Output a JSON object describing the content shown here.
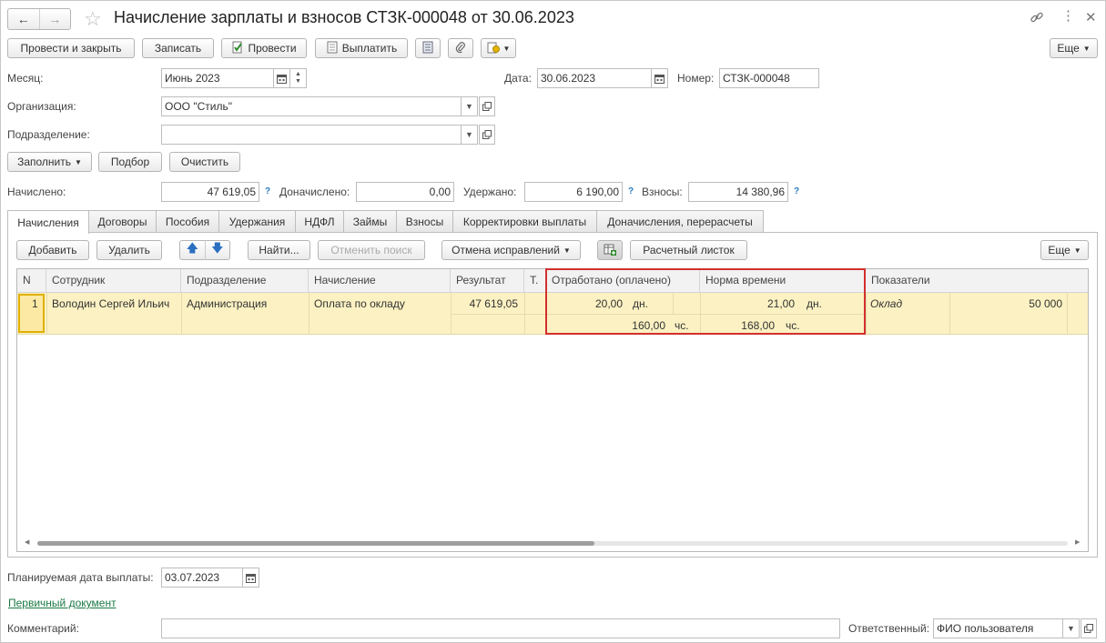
{
  "window": {
    "title": "Начисление зарплаты и взносов СТЗК-000048 от 30.06.2023"
  },
  "toolbar": {
    "post_close": "Провести и закрыть",
    "save": "Записать",
    "post": "Провести",
    "pay": "Выплатить",
    "more": "Еще"
  },
  "header": {
    "month_label": "Месяц:",
    "month_value": "Июнь 2023",
    "date_label": "Дата:",
    "date_value": "30.06.2023",
    "number_label": "Номер:",
    "number_value": "СТЗК-000048",
    "org_label": "Организация:",
    "org_value": "ООО \"Стиль\"",
    "dept_label": "Подразделение:",
    "dept_value": ""
  },
  "actions": {
    "fill": "Заполнить",
    "select": "Подбор",
    "clear": "Очистить"
  },
  "totals": {
    "accrued_label": "Начислено:",
    "accrued_value": "47 619,05",
    "additional_label": "Доначислено:",
    "additional_value": "0,00",
    "withheld_label": "Удержано:",
    "withheld_value": "6 190,00",
    "contrib_label": "Взносы:",
    "contrib_value": "14 380,96",
    "help": "?"
  },
  "tabs": [
    {
      "label": "Начисления"
    },
    {
      "label": "Договоры"
    },
    {
      "label": "Пособия"
    },
    {
      "label": "Удержания"
    },
    {
      "label": "НДФЛ"
    },
    {
      "label": "Займы"
    },
    {
      "label": "Взносы"
    },
    {
      "label": "Корректировки выплаты"
    },
    {
      "label": "Доначисления, перерасчеты"
    }
  ],
  "tab_toolbar": {
    "add": "Добавить",
    "delete": "Удалить",
    "find": "Найти...",
    "cancel_search": "Отменить поиск",
    "cancel_corrections": "Отмена исправлений",
    "payslip": "Расчетный листок",
    "more": "Еще"
  },
  "table": {
    "columns": [
      "N",
      "Сотрудник",
      "Подразделение",
      "Начисление",
      "Результат",
      "Т.",
      "Отработано (оплачено)",
      "Норма времени",
      "Показатели"
    ],
    "rows": [
      {
        "n": "1",
        "employee": "Володин Сергей Ильич",
        "department": "Администрация",
        "accrual": "Оплата по окладу",
        "result": "47 619,05",
        "worked_days": "20,00",
        "worked_days_unit": "дн.",
        "worked_hours": "160,00",
        "worked_hours_unit": "чс.",
        "norm_days": "21,00",
        "norm_days_unit": "дн.",
        "norm_hours": "168,00",
        "norm_hours_unit": "чс.",
        "indicator_name": "Оклад",
        "indicator_value": "50 000"
      }
    ]
  },
  "footer": {
    "pay_date_label": "Планируемая дата выплаты:",
    "pay_date_value": "03.07.2023",
    "primary_doc_link": "Первичный документ",
    "comment_label": "Комментарий:",
    "comment_value": "",
    "responsible_label": "Ответственный:",
    "responsible_value": "ФИО пользователя"
  },
  "colors": {
    "highlight_border": "#d32f2f",
    "selected_row": "#fbf1c2",
    "link": "#1a7a43",
    "help": "#2a7ac0"
  }
}
